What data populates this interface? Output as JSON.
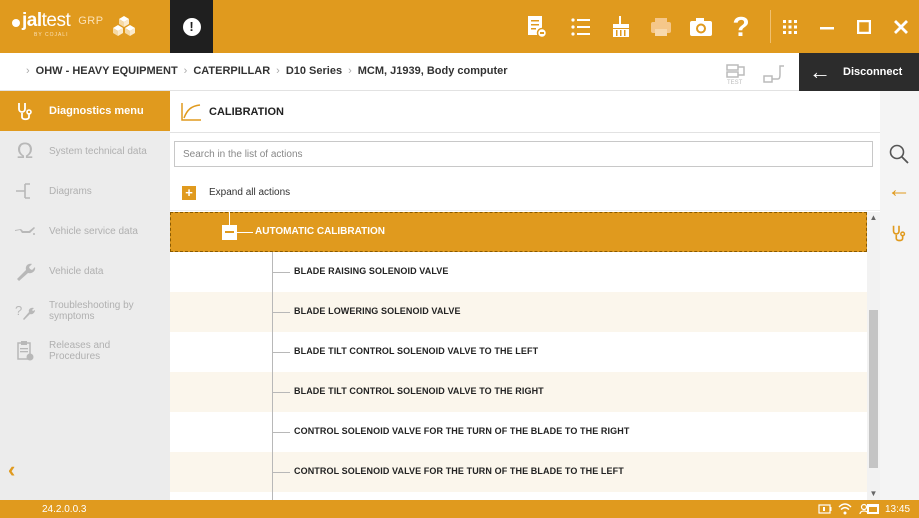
{
  "app": {
    "logo_bold": "jal",
    "logo_light": "test",
    "logo_sub": "BY COJALI",
    "logo_tag": "GRP"
  },
  "breadcrumb": [
    "OHW - HEAVY EQUIPMENT",
    "CATERPILLAR",
    "D10 Series",
    "MCM, J1939, Body computer"
  ],
  "test_label": "TEST",
  "disconnect_label": "Disconnect",
  "sidebar": {
    "items": [
      {
        "label": "Diagnostics menu",
        "icon": "stethoscope-icon"
      },
      {
        "label": "System technical data",
        "icon": "omega-icon"
      },
      {
        "label": "Diagrams",
        "icon": "diagram-icon"
      },
      {
        "label": "Vehicle service data",
        "icon": "oil-can-icon"
      },
      {
        "label": "Vehicle data",
        "icon": "wrench-icon"
      },
      {
        "label": "Troubleshooting by symptoms",
        "icon": "troubleshoot-icon"
      },
      {
        "label": "Releases and Procedures",
        "icon": "clipboard-icon"
      }
    ]
  },
  "main": {
    "title": "CALIBRATION",
    "search_placeholder": "Search in the list of actions",
    "expand_label": "Expand all actions",
    "group_label": "AUTOMATIC CALIBRATION",
    "actions": [
      "BLADE RAISING SOLENOID VALVE",
      "BLADE LOWERING SOLENOID VALVE",
      "BLADE TILT CONTROL SOLENOID VALVE TO THE LEFT",
      "BLADE TILT CONTROL SOLENOID VALVE TO THE RIGHT",
      "CONTROL SOLENOID VALVE FOR THE TURN OF THE BLADE TO THE RIGHT",
      "CONTROL SOLENOID VALVE FOR THE TURN OF THE BLADE TO THE LEFT"
    ]
  },
  "status": {
    "version": "24.2.0.0.3",
    "time": "13:45"
  },
  "colors": {
    "accent": "#e09a1e",
    "dark": "#2c2c2c"
  }
}
